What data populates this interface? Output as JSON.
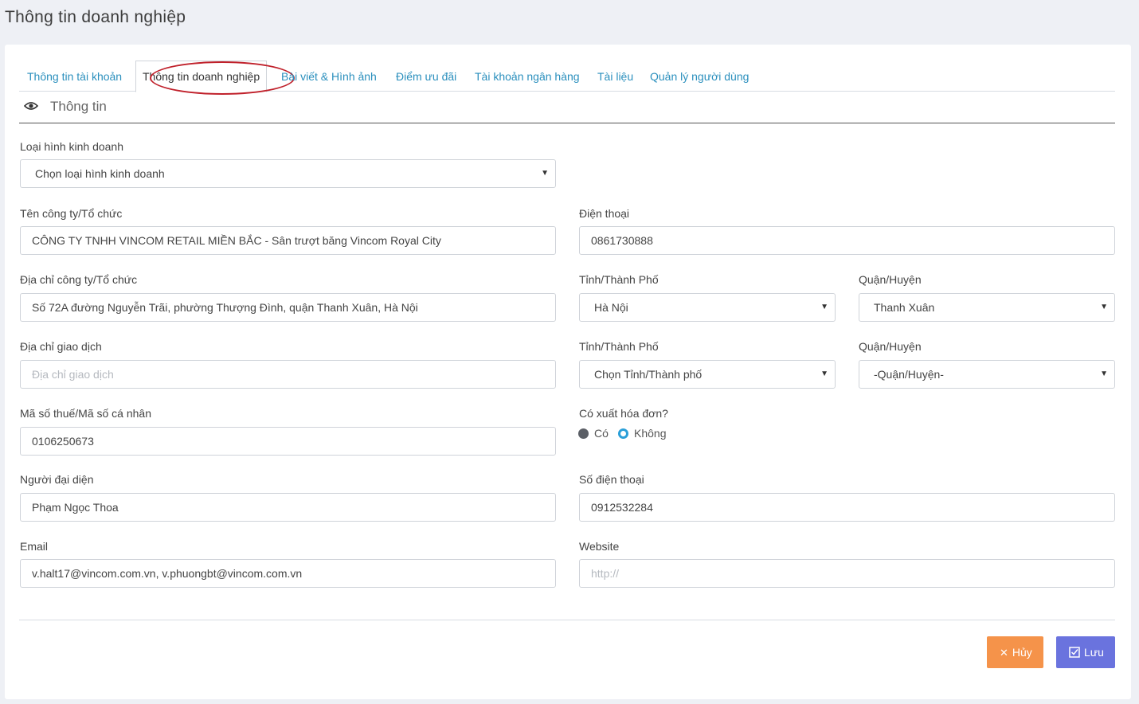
{
  "page": {
    "title": "Thông tin doanh nghiệp"
  },
  "tabs": [
    {
      "label": "Thông tin tài khoản",
      "active": false
    },
    {
      "label": "Thông tin doanh nghiệp",
      "active": true
    },
    {
      "label": "Bài viết & Hình ảnh",
      "active": false
    },
    {
      "label": "Điểm ưu đãi",
      "active": false
    },
    {
      "label": "Tài khoản ngân hàng",
      "active": false
    },
    {
      "label": "Tài liệu",
      "active": false
    },
    {
      "label": "Quản lý người dùng",
      "active": false
    }
  ],
  "section": {
    "title": "Thông tin",
    "icon": "eye-icon"
  },
  "form": {
    "business_type": {
      "label": "Loại hình kinh doanh",
      "value": "Chọn loại hình kinh doanh"
    },
    "company_name": {
      "label": "Tên công ty/Tổ chức",
      "value": "CÔNG TY TNHH VINCOM RETAIL MIỀN BẮC - Sân trượt băng Vincom Royal City"
    },
    "phone": {
      "label": "Điện thoại",
      "value": "0861730888"
    },
    "company_address": {
      "label": "Địa chỉ công ty/Tổ chức",
      "value": "Số 72A đường Nguyễn Trãi, phường Thượng Đình, quận Thanh Xuân, Hà Nội"
    },
    "province_1": {
      "label": "Tỉnh/Thành Phố",
      "value": "Hà Nội"
    },
    "district_1": {
      "label": "Quận/Huyện",
      "value": "Thanh Xuân"
    },
    "transaction_address": {
      "label": "Địa chỉ giao dịch",
      "placeholder": "Địa chỉ giao dịch"
    },
    "province_2": {
      "label": "Tỉnh/Thành Phố",
      "value": "Chọn Tỉnh/Thành phố"
    },
    "district_2": {
      "label": "Quận/Huyện",
      "value": "-Quận/Huyện-"
    },
    "tax_code": {
      "label": "Mã số thuế/Mã số cá nhân",
      "value": "0106250673"
    },
    "invoice": {
      "label": "Có xuất hóa đơn?",
      "option_yes": "Có",
      "option_no": "Không",
      "selected": "Không"
    },
    "representative": {
      "label": "Người đại diện",
      "value": "Phạm Ngọc Thoa"
    },
    "mobile": {
      "label": "Số điện thoại",
      "value": "0912532284"
    },
    "email": {
      "label": "Email",
      "value": "v.halt17@vincom.com.vn, v.phuongbt@vincom.com.vn"
    },
    "website": {
      "label": "Website",
      "placeholder": "http://"
    }
  },
  "buttons": {
    "cancel_label": "Hủy",
    "save_label": "Lưu"
  },
  "colors": {
    "tab_link": "#2a8fbd",
    "cancel": "#f5934a",
    "save": "#6a73de",
    "annotation": "#c0212b"
  }
}
